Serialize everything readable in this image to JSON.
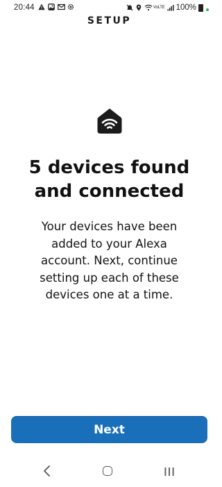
{
  "status_bar": {
    "time": "20:44",
    "battery": "100%",
    "left_icons": [
      "alert-icon",
      "photo-icon",
      "gmail-icon",
      "settings-icon"
    ],
    "right_icons": [
      "mute-icon",
      "location-icon",
      "wifi-icon",
      "volte-signal-icon",
      "signal-icon",
      "battery-icon"
    ],
    "signal_label": "VoLTE"
  },
  "header": {
    "title": "SETUP"
  },
  "main": {
    "icon": "smart-home-wifi-icon",
    "headline_line1": "5 devices found",
    "headline_line2": "and connected",
    "body": "Your devices have been added to your Alexa account. Next, continue setting up each of these devices one at a time."
  },
  "actions": {
    "next_label": "Next"
  },
  "colors": {
    "primary_button": "#1a6fbb",
    "text": "#111111",
    "background": "#ffffff",
    "status_dot": "#37b24d"
  },
  "navigation": {
    "items": [
      "back-icon",
      "home-icon",
      "recents-icon"
    ]
  }
}
